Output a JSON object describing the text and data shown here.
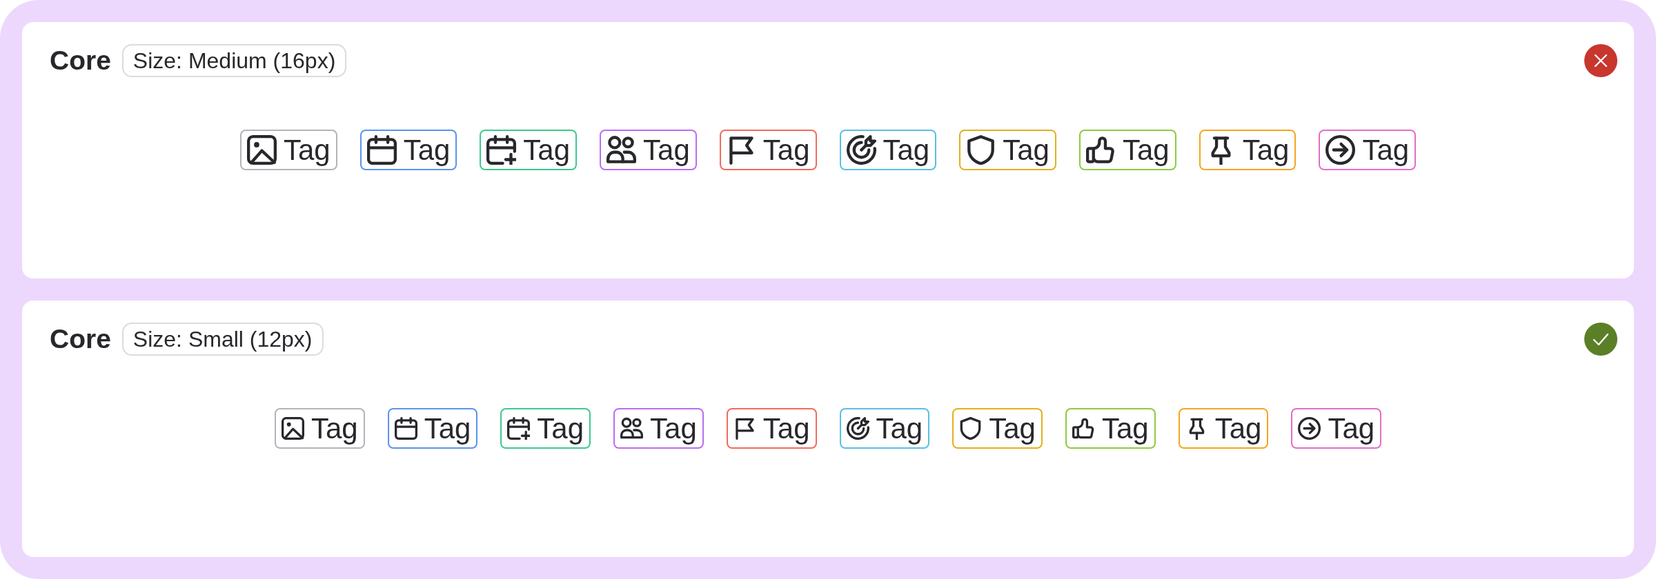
{
  "panels": [
    {
      "title": "Core",
      "size_label": "Size: Medium (16px)",
      "kind": "medium",
      "passed": false,
      "tags": [
        {
          "kind": "image",
          "label": "Tag",
          "color": "#b4b4b8"
        },
        {
          "kind": "calendar",
          "label": "Tag",
          "color": "#5b93ee"
        },
        {
          "kind": "calendarplus",
          "label": "Tag",
          "color": "#3ec98e"
        },
        {
          "kind": "users",
          "label": "Tag",
          "color": "#bb6cf3"
        },
        {
          "kind": "flag",
          "label": "Tag",
          "color": "#f26b5c"
        },
        {
          "kind": "target",
          "label": "Tag",
          "color": "#5bbfe3"
        },
        {
          "kind": "shield",
          "label": "Tag",
          "color": "#e3b01e"
        },
        {
          "kind": "thumbsup",
          "label": "Tag",
          "color": "#8fca3e"
        },
        {
          "kind": "pin",
          "label": "Tag",
          "color": "#f5a51f"
        },
        {
          "kind": "arrowright",
          "label": "Tag",
          "color": "#e56cc6"
        }
      ]
    },
    {
      "title": "Core",
      "size_label": "Size: Small (12px)",
      "kind": "small",
      "passed": true,
      "tags": [
        {
          "kind": "image",
          "label": "Tag",
          "color": "#b4b4b8"
        },
        {
          "kind": "calendar",
          "label": "Tag",
          "color": "#5b93ee"
        },
        {
          "kind": "calendarplus",
          "label": "Tag",
          "color": "#3ec98e"
        },
        {
          "kind": "users",
          "label": "Tag",
          "color": "#bb6cf3"
        },
        {
          "kind": "flag",
          "label": "Tag",
          "color": "#f26b5c"
        },
        {
          "kind": "target",
          "label": "Tag",
          "color": "#5bbfe3"
        },
        {
          "kind": "shield",
          "label": "Tag",
          "color": "#e3b01e"
        },
        {
          "kind": "thumbsup",
          "label": "Tag",
          "color": "#8fca3e"
        },
        {
          "kind": "pin",
          "label": "Tag",
          "color": "#f5a51f"
        },
        {
          "kind": "arrowright",
          "label": "Tag",
          "color": "#e56cc6"
        }
      ]
    }
  ]
}
